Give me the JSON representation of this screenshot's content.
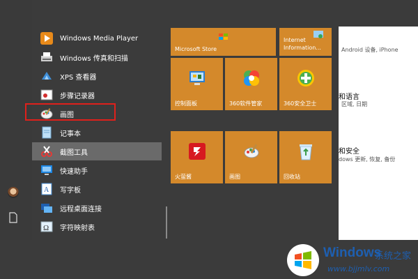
{
  "start_menu": {
    "apps": [
      {
        "label": "Windows Media Player",
        "icon": "media-player-icon"
      },
      {
        "label": "Windows 传真和扫描",
        "icon": "fax-scan-icon"
      },
      {
        "label": "XPS 查看器",
        "icon": "xps-viewer-icon"
      },
      {
        "label": "步骤记录器",
        "icon": "steps-recorder-icon"
      },
      {
        "label": "画图",
        "icon": "paint-icon"
      },
      {
        "label": "记事本",
        "icon": "notepad-icon"
      },
      {
        "label": "截图工具",
        "icon": "snipping-tool-icon"
      },
      {
        "label": "快速助手",
        "icon": "quick-assist-icon"
      },
      {
        "label": "写字板",
        "icon": "wordpad-icon"
      },
      {
        "label": "远程桌面连接",
        "icon": "remote-desktop-icon"
      },
      {
        "label": "字符映射表",
        "icon": "character-map-icon"
      }
    ],
    "selected_app": "截图工具",
    "highlighted_app": "画图"
  },
  "tiles": [
    {
      "label": "Microsoft Store",
      "icon": "store-icon"
    },
    {
      "label": "Internet Information...",
      "icon": "iis-icon"
    },
    {
      "label": "控制面板",
      "icon": "control-panel-icon"
    },
    {
      "label": "360软件管家",
      "icon": "360-software-icon"
    },
    {
      "label": "360安全卫士",
      "icon": "360-security-icon"
    },
    {
      "label": "火萤酱",
      "icon": "firefly-icon"
    },
    {
      "label": "画图",
      "icon": "paint-icon"
    },
    {
      "label": "回收站",
      "icon": "recycle-bin-icon"
    }
  ],
  "settings_window": {
    "line1": "Android 设备, iPhone",
    "head2": "和语言",
    "line2": "区域, 日期",
    "head3": "和安全",
    "line3": "dows 更新, 恢复, 备份"
  },
  "watermark": {
    "title": "Windows",
    "subtitle": "系统之家",
    "url": "www.bjjmlv.com"
  },
  "colors": {
    "tile": "#d4892b",
    "start_bg": "#3b3b3b",
    "highlight_box": "#e0201b",
    "selected_row": "#6a6a6a"
  }
}
